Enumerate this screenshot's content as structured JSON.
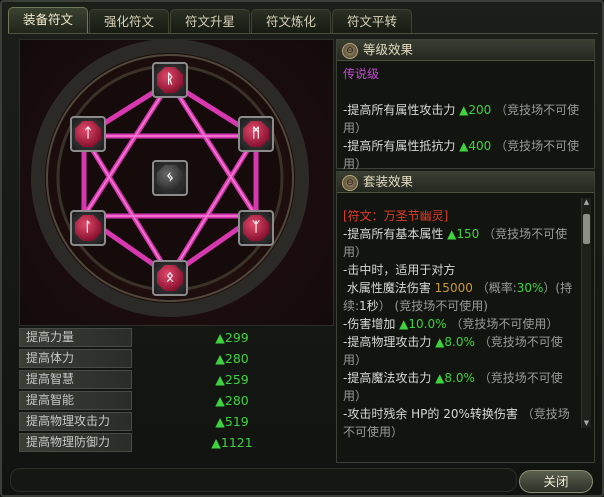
{
  "tabs": [
    "装备符文",
    "强化符文",
    "符文升星",
    "符文炼化",
    "符文平转"
  ],
  "runes": {
    "top": "ᚱ",
    "upper_left": "ᛏ",
    "upper_right": "ᛗ",
    "center": "ᛃ",
    "lower_left": "ᛚ",
    "lower_right": "ᛉ",
    "bottom": "ᛟ"
  },
  "attributes": [
    {
      "name": "提高力量",
      "value": "▲299"
    },
    {
      "name": "提高体力",
      "value": "▲280"
    },
    {
      "name": "提高智慧",
      "value": "▲259"
    },
    {
      "name": "提高智能",
      "value": "▲280"
    },
    {
      "name": "提高物理攻击力",
      "value": "▲519"
    },
    {
      "name": "提高物理防御力",
      "value": "▲1121"
    }
  ],
  "level_panel": {
    "title": "等级效果",
    "grade": "传说级",
    "line1_label": "-提高所有属性攻击力",
    "line1_value": "▲200",
    "line1_note": "（竞技场不可使用）",
    "line2_label": "-提高所有属性抵抗力",
    "line2_value": "▲400",
    "line2_note": "（竞技场不可使用）"
  },
  "set_panel": {
    "title": "套装效果",
    "set_name": "[符文：万圣节幽灵]",
    "e1_label": "-提高所有基本属性",
    "e1_value": "▲150",
    "e1_note": "（竞技场不可使用）",
    "e2_line1": "-击中时，适用于对方",
    "e2_line2a": "水属性魔法伤害",
    "e2_value": "15000",
    "e2_line2b": "（概率:",
    "e2_prob": "30%",
    "e2_dur_a": "）(持续:",
    "e2_dur": "1秒",
    "e2_dur_b": "）",
    "e2_note": "(竞技场不可使用)",
    "e3_label": "-伤害增加",
    "e3_value": "▲10.0%",
    "e3_note": "（竞技场不可使用）",
    "e4_label": "-提高物理攻击力",
    "e4_value": "▲8.0%",
    "e4_note": "（竞技场不可使用）",
    "e5_label": "-提高魔法攻击力",
    "e5_value": "▲8.0%",
    "e5_note": "（竞技场不可使用）",
    "e6_label": "-攻击时残余 HP的 20%转换伤害",
    "e6_note": "（竞技场不可使用）"
  },
  "close_label": "关闭",
  "colors": {
    "green": "#3fd23f",
    "pink_line": "#e23bb8",
    "legend": "#c24ad4"
  }
}
